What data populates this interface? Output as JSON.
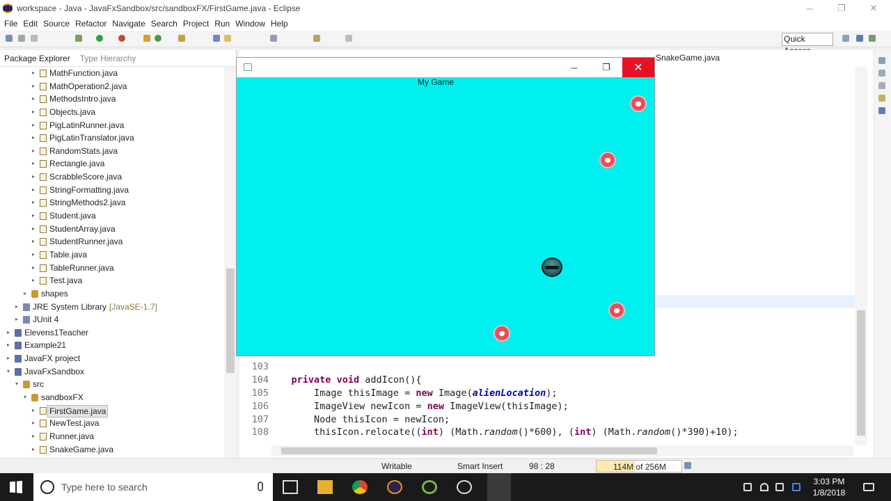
{
  "window": {
    "title": "workspace - Java - JavaFxSandbox/src/sandboxFX/FirstGame.java - Eclipse",
    "minimize": "─",
    "maximize": "❐",
    "close": "✕"
  },
  "menu": [
    "File",
    "Edit",
    "Source",
    "Refactor",
    "Navigate",
    "Search",
    "Project",
    "Run",
    "Window",
    "Help"
  ],
  "toolbar": {
    "quick_access": "Quick Access"
  },
  "package_explorer": {
    "tabs": [
      "Package Explorer",
      "Type Hierarchy"
    ],
    "items": [
      {
        "label": "MathFunction.java",
        "level": 4,
        "type": "java"
      },
      {
        "label": "MathOperation2.java",
        "level": 4,
        "type": "java"
      },
      {
        "label": "MethodsIntro.java",
        "level": 4,
        "type": "java"
      },
      {
        "label": "Objects.java",
        "level": 4,
        "type": "java"
      },
      {
        "label": "PigLatinRunner.java",
        "level": 4,
        "type": "java"
      },
      {
        "label": "PigLatinTranslator.java",
        "level": 4,
        "type": "java"
      },
      {
        "label": "RandomStats.java",
        "level": 4,
        "type": "java"
      },
      {
        "label": "Rectangle.java",
        "level": 4,
        "type": "java"
      },
      {
        "label": "ScrabbleScore.java",
        "level": 4,
        "type": "java"
      },
      {
        "label": "StringFormatting.java",
        "level": 4,
        "type": "java"
      },
      {
        "label": "StringMethods2.java",
        "level": 4,
        "type": "java"
      },
      {
        "label": "Student.java",
        "level": 4,
        "type": "java"
      },
      {
        "label": "StudentArray.java",
        "level": 4,
        "type": "java"
      },
      {
        "label": "StudentRunner.java",
        "level": 4,
        "type": "java"
      },
      {
        "label": "Table.java",
        "level": 4,
        "type": "java"
      },
      {
        "label": "TableRunner.java",
        "level": 4,
        "type": "java"
      },
      {
        "label": "Test.java",
        "level": 4,
        "type": "java"
      },
      {
        "label": "shapes",
        "level": 3,
        "type": "package"
      },
      {
        "label": "JRE System Library",
        "suffix": "[JavaSE-1.7]",
        "level": 2,
        "type": "jre"
      },
      {
        "label": "JUnit 4",
        "level": 2,
        "type": "jre"
      },
      {
        "label": "Elevens1Teacher",
        "level": 1,
        "type": "project"
      },
      {
        "label": "Example21",
        "level": 1,
        "type": "project"
      },
      {
        "label": "JavaFX project",
        "level": 1,
        "type": "project"
      },
      {
        "label": "JavaFxSandbox",
        "level": 1,
        "type": "project",
        "expanded": true
      },
      {
        "label": "src",
        "level": 2,
        "type": "package",
        "expanded": true
      },
      {
        "label": "sandboxFX",
        "level": 3,
        "type": "package",
        "expanded": true
      },
      {
        "label": "FirstGame.java",
        "level": 4,
        "type": "java",
        "selected": true
      },
      {
        "label": "NewTest.java",
        "level": 4,
        "type": "java"
      },
      {
        "label": "Runner.java",
        "level": 4,
        "type": "java"
      },
      {
        "label": "SnakeGame.java",
        "level": 4,
        "type": "java"
      }
    ]
  },
  "editor": {
    "tab": "SnakeGame.java",
    "lines": [
      {
        "n": "103",
        "code": ""
      },
      {
        "n": "104",
        "code": "private void addIcon(){"
      },
      {
        "n": "105",
        "code": "Image thisImage = new Image(alienLocation);"
      },
      {
        "n": "106",
        "code": "ImageView newIcon = new ImageView(thisImage);"
      },
      {
        "n": "107",
        "code": "Node thisIcon = newIcon;"
      },
      {
        "n": "108",
        "code": "thisIcon.relocate((int) (Math.random()*600), (int) (Math.random()*390)+10);"
      }
    ]
  },
  "status": {
    "writable": "Writable",
    "insert": "Smart Insert",
    "position": "98 : 28",
    "heap_used": "114M",
    "heap_of": "of 256M"
  },
  "game": {
    "title": "My Game",
    "bg": "#00f0f0"
  },
  "taskbar": {
    "search_placeholder": "Type here to search",
    "time": "3:03 PM",
    "date": "1/8/2018"
  },
  "colors": {
    "close_red": "#e81123",
    "keyword": "#7f0055",
    "field": "#0000c0"
  }
}
